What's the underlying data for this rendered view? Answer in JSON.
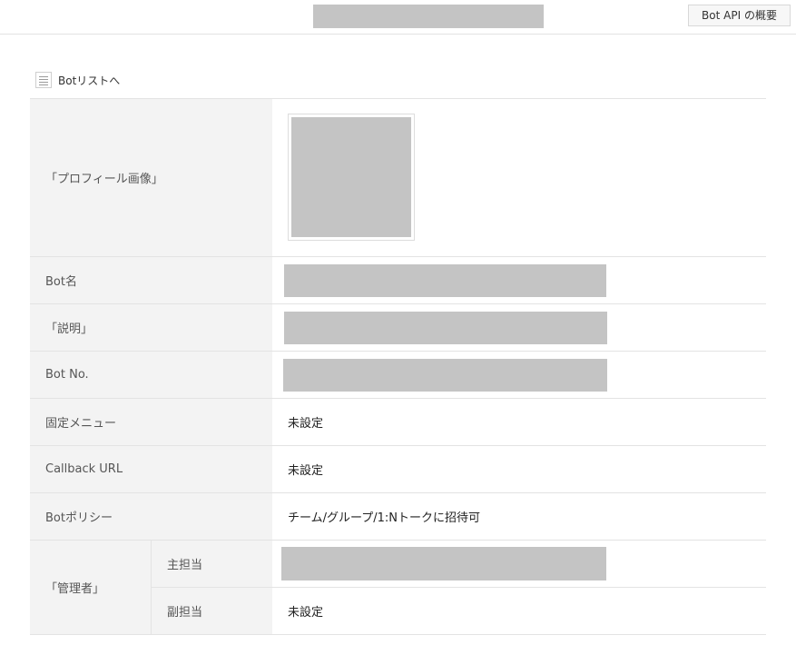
{
  "header": {
    "api_overview_label": "Bot API の概要"
  },
  "nav": {
    "back_label": "Botリストへ",
    "back_icon": "list-icon"
  },
  "details": {
    "profile_image_label": "「プロフィール画像」",
    "bot_name_label": "Bot名",
    "description_label": "「説明」",
    "bot_no_label": "Bot No.",
    "fixed_menu_label": "固定メニュー",
    "fixed_menu_value": "未設定",
    "callback_url_label": "Callback URL",
    "callback_url_value": "未設定",
    "bot_policy_label": "Botポリシー",
    "bot_policy_value": "チーム/グループ/1:Nトークに招待可",
    "admins_label": "「管理者」",
    "primary_admin_label": "主担当",
    "secondary_admin_label": "副担当",
    "secondary_admin_value": "未設定"
  },
  "colors": {
    "redacted": "#c4c4c4",
    "label_bg": "#f3f3f3",
    "border": "#e3e3e3"
  }
}
